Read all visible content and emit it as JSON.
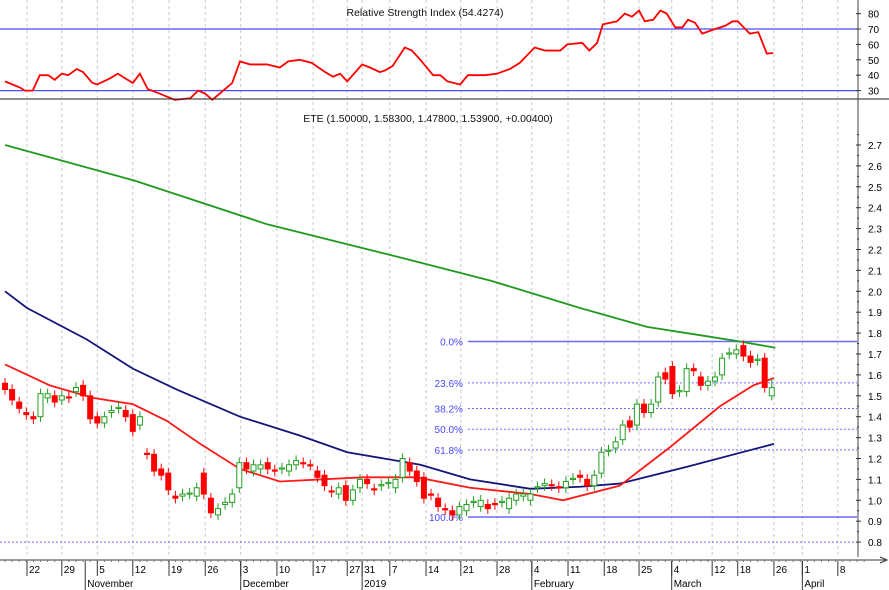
{
  "chart_data": {
    "type": "candlestick",
    "symbol": "ETE",
    "title": "ETE (1.50000, 1.58300, 1.47800, 1.53900, +0.00400)",
    "last_bar": {
      "open": 1.5,
      "high": 1.583,
      "low": 1.478,
      "close": 1.539,
      "change": 0.004
    },
    "ylim": [
      0.75,
      2.78
    ],
    "y_ticks": [
      "0.8",
      "0.9",
      "1.0",
      "1.1",
      "1.2",
      "1.3",
      "1.4",
      "1.5",
      "1.6",
      "1.7",
      "1.8",
      "1.9",
      "2.0",
      "2.1",
      "2.2",
      "2.3",
      "2.4",
      "2.5",
      "2.6",
      "2.7"
    ],
    "x_ticks": [
      {
        "label": "22",
        "i": 3.1
      },
      {
        "label": "29",
        "i": 8.0
      },
      {
        "label": "5",
        "i": 13.0
      },
      {
        "label": "12",
        "i": 18.0
      },
      {
        "label": "19",
        "i": 23.1
      },
      {
        "label": "26",
        "i": 28.2
      },
      {
        "label": "3",
        "i": 33.2
      },
      {
        "label": "10",
        "i": 38.3
      },
      {
        "label": "17",
        "i": 43.4
      },
      {
        "label": "27",
        "i": 48.2
      },
      {
        "label": "31",
        "i": 50.3
      },
      {
        "label": "7",
        "i": 54.2
      },
      {
        "label": "14",
        "i": 59.3
      },
      {
        "label": "21",
        "i": 64.2
      },
      {
        "label": "28",
        "i": 69.3
      },
      {
        "label": "4",
        "i": 74.2
      },
      {
        "label": "11",
        "i": 79.3
      },
      {
        "label": "18",
        "i": 84.4
      },
      {
        "label": "25",
        "i": 89.3
      },
      {
        "label": "4",
        "i": 93.9
      },
      {
        "label": "12",
        "i": 99.6
      },
      {
        "label": "18",
        "i": 103.2
      },
      {
        "label": "26",
        "i": 108.3
      },
      {
        "label": "1",
        "i": 112.3
      },
      {
        "label": "8",
        "i": 117.3
      }
    ],
    "months": [
      {
        "label": "November",
        "i": 11.3
      },
      {
        "label": "December",
        "i": 33.2
      },
      {
        "label": "2019",
        "i": 50.3
      },
      {
        "label": "February",
        "i": 74.2
      },
      {
        "label": "March",
        "i": 93.9
      },
      {
        "label": "April",
        "i": 112.3
      }
    ],
    "candles_oc": [
      [
        1.56,
        1.53
      ],
      [
        1.53,
        1.48
      ],
      [
        1.47,
        1.44
      ],
      [
        1.42,
        1.41
      ],
      [
        1.4,
        1.39
      ],
      [
        1.4,
        1.51
      ],
      [
        1.49,
        1.51
      ],
      [
        1.5,
        1.47
      ],
      [
        1.48,
        1.5
      ],
      [
        1.495,
        1.49
      ],
      [
        1.52,
        1.54
      ],
      [
        1.55,
        1.5
      ],
      [
        1.5,
        1.39
      ],
      [
        1.4,
        1.37
      ],
      [
        1.37,
        1.4
      ],
      [
        1.42,
        1.43
      ],
      [
        1.44,
        1.445
      ],
      [
        1.43,
        1.4
      ],
      [
        1.41,
        1.33
      ],
      [
        1.36,
        1.4
      ],
      [
        1.225,
        1.22
      ],
      [
        1.22,
        1.14
      ],
      [
        1.15,
        1.12
      ],
      [
        1.13,
        1.05
      ],
      [
        1.02,
        1.01
      ],
      [
        1.02,
        1.03
      ],
      [
        1.03,
        1.035
      ],
      [
        1.02,
        1.06
      ],
      [
        1.13,
        1.03
      ],
      [
        1.01,
        0.94
      ],
      [
        0.93,
        0.96
      ],
      [
        0.98,
        0.99
      ],
      [
        0.99,
        1.03
      ],
      [
        1.06,
        1.18
      ],
      [
        1.18,
        1.15
      ],
      [
        1.14,
        1.17
      ],
      [
        1.15,
        1.17
      ],
      [
        1.18,
        1.15
      ],
      [
        1.145,
        1.14
      ],
      [
        1.15,
        1.155
      ],
      [
        1.14,
        1.17
      ],
      [
        1.17,
        1.19
      ],
      [
        1.18,
        1.178
      ],
      [
        1.17,
        1.168
      ],
      [
        1.14,
        1.11
      ],
      [
        1.12,
        1.07
      ],
      [
        1.045,
        1.04
      ],
      [
        1.03,
        1.06
      ],
      [
        1.07,
        1.0
      ],
      [
        1.0,
        1.05
      ],
      [
        1.06,
        1.1
      ],
      [
        1.1,
        1.08
      ],
      [
        1.055,
        1.05
      ],
      [
        1.07,
        1.075
      ],
      [
        1.08,
        1.085
      ],
      [
        1.06,
        1.1
      ],
      [
        1.11,
        1.2
      ],
      [
        1.18,
        1.14
      ],
      [
        1.14,
        1.09
      ],
      [
        1.11,
        1.01
      ],
      [
        1.03,
        1.025
      ],
      [
        1.01,
        0.97
      ],
      [
        0.96,
        0.955
      ],
      [
        0.95,
        0.93
      ],
      [
        0.93,
        0.97
      ],
      [
        0.95,
        0.98
      ],
      [
        0.99,
        0.995
      ],
      [
        0.97,
        1.0
      ],
      [
        0.98,
        0.96
      ],
      [
        0.985,
        0.98
      ],
      [
        0.99,
        0.995
      ],
      [
        0.96,
        1.01
      ],
      [
        1.0,
        1.03
      ],
      [
        1.02,
        1.03
      ],
      [
        1.0,
        1.03
      ],
      [
        1.06,
        1.065
      ],
      [
        1.07,
        1.08
      ],
      [
        1.075,
        1.07
      ],
      [
        1.065,
        1.06
      ],
      [
        1.06,
        1.09
      ],
      [
        1.1,
        1.105
      ],
      [
        1.12,
        1.11
      ],
      [
        1.1,
        1.07
      ],
      [
        1.07,
        1.12
      ],
      [
        1.13,
        1.23
      ],
      [
        1.235,
        1.24
      ],
      [
        1.25,
        1.28
      ],
      [
        1.29,
        1.36
      ],
      [
        1.38,
        1.35
      ],
      [
        1.36,
        1.46
      ],
      [
        1.46,
        1.42
      ],
      [
        1.42,
        1.46
      ],
      [
        1.47,
        1.59
      ],
      [
        1.61,
        1.58
      ],
      [
        1.64,
        1.51
      ],
      [
        1.52,
        1.525
      ],
      [
        1.52,
        1.63
      ],
      [
        1.63,
        1.62
      ],
      [
        1.59,
        1.55
      ],
      [
        1.55,
        1.57
      ],
      [
        1.57,
        1.59
      ],
      [
        1.6,
        1.68
      ],
      [
        1.7,
        1.705
      ],
      [
        1.7,
        1.72
      ],
      [
        1.74,
        1.69
      ],
      [
        1.69,
        1.66
      ],
      [
        1.67,
        1.675
      ],
      [
        1.68,
        1.54
      ],
      [
        1.5,
        1.539
      ]
    ],
    "moving_averages": [
      {
        "name": "long",
        "color": "#1f9a1f",
        "points": [
          [
            0,
            2.7
          ],
          [
            18.2,
            2.53
          ],
          [
            37,
            2.32
          ],
          [
            55.9,
            2.16
          ],
          [
            68.5,
            2.05
          ],
          [
            81,
            1.92
          ],
          [
            90.4,
            1.83
          ],
          [
            97.9,
            1.79
          ],
          [
            103.5,
            1.76
          ],
          [
            108.5,
            1.73
          ]
        ]
      },
      {
        "name": "medium",
        "color": "#14147a",
        "points": [
          [
            0,
            2.0
          ],
          [
            3.1,
            1.92
          ],
          [
            11.5,
            1.77
          ],
          [
            18,
            1.63
          ],
          [
            24.2,
            1.53
          ],
          [
            33.1,
            1.4
          ],
          [
            41.5,
            1.31
          ],
          [
            48.2,
            1.23
          ],
          [
            58.5,
            1.17
          ],
          [
            65.5,
            1.1
          ],
          [
            74,
            1.055
          ],
          [
            81,
            1.065
          ],
          [
            86.6,
            1.08
          ],
          [
            96,
            1.16
          ],
          [
            108.3,
            1.27
          ]
        ]
      },
      {
        "name": "short",
        "color": "#ff1a1a",
        "points": [
          [
            0,
            1.65
          ],
          [
            6.3,
            1.55
          ],
          [
            12.4,
            1.49
          ],
          [
            18,
            1.46
          ],
          [
            22.8,
            1.38
          ],
          [
            27.5,
            1.27
          ],
          [
            33.1,
            1.15
          ],
          [
            38.7,
            1.09
          ],
          [
            50.4,
            1.11
          ],
          [
            58,
            1.11
          ],
          [
            65.5,
            1.06
          ],
          [
            74,
            1.03
          ],
          [
            78.6,
            1.0
          ],
          [
            86.6,
            1.07
          ],
          [
            93.7,
            1.255
          ],
          [
            100.7,
            1.45
          ],
          [
            105.4,
            1.55
          ],
          [
            108.3,
            1.585
          ]
        ]
      }
    ],
    "fibonacci": {
      "high": 1.76,
      "low": 0.92,
      "anchor_i": 65.2,
      "levels": [
        {
          "label": "0.0%",
          "value": 1.76,
          "style": "solid"
        },
        {
          "label": "23.6%",
          "value": 1.562,
          "style": "dotted"
        },
        {
          "label": "38.2%",
          "value": 1.439,
          "style": "dotted"
        },
        {
          "label": "50.0%",
          "value": 1.34,
          "style": "dotted"
        },
        {
          "label": "61.8%",
          "value": 1.241,
          "style": "dotted"
        },
        {
          "label": "100.0%",
          "value": 0.92,
          "style": "solid"
        }
      ],
      "extra_line": 0.8
    },
    "rsi": {
      "title": "Relative Strength Index (54.4274)",
      "ylim": [
        20,
        90
      ],
      "levels": [
        70,
        30
      ],
      "y_ticks": [
        "80",
        "70",
        "60",
        "50",
        "40",
        "30"
      ],
      "points": [
        [
          0,
          36
        ],
        [
          2.1,
          32
        ],
        [
          2.8,
          30
        ],
        [
          3.9,
          30
        ],
        [
          4.9,
          40
        ],
        [
          6.1,
          40
        ],
        [
          7,
          37
        ],
        [
          8,
          41
        ],
        [
          8.9,
          40
        ],
        [
          10.1,
          44
        ],
        [
          11,
          42
        ],
        [
          12.3,
          35
        ],
        [
          13,
          34
        ],
        [
          14.8,
          38
        ],
        [
          15.9,
          41
        ],
        [
          16.9,
          38
        ],
        [
          18,
          35
        ],
        [
          19,
          41
        ],
        [
          20.1,
          31
        ],
        [
          21.8,
          28
        ],
        [
          23.9,
          24
        ],
        [
          26.1,
          25
        ],
        [
          27.2,
          30
        ],
        [
          28.2,
          28
        ],
        [
          29.2,
          24
        ],
        [
          31,
          31
        ],
        [
          32,
          35
        ],
        [
          33.1,
          49
        ],
        [
          34.5,
          47
        ],
        [
          35.2,
          47
        ],
        [
          36.9,
          47
        ],
        [
          38.7,
          45
        ],
        [
          39.9,
          49
        ],
        [
          41.5,
          50
        ],
        [
          43.2,
          48
        ],
        [
          45.1,
          42
        ],
        [
          46.2,
          39
        ],
        [
          47.2,
          41
        ],
        [
          48.2,
          36
        ],
        [
          50.3,
          47
        ],
        [
          51.4,
          45
        ],
        [
          52.8,
          42
        ],
        [
          53.5,
          43
        ],
        [
          54.6,
          46
        ],
        [
          56.3,
          58
        ],
        [
          57.3,
          56
        ],
        [
          58.5,
          50
        ],
        [
          60.3,
          40
        ],
        [
          61.3,
          40
        ],
        [
          62.3,
          36
        ],
        [
          64.1,
          34
        ],
        [
          65.2,
          40
        ],
        [
          67.6,
          40
        ],
        [
          69.3,
          41
        ],
        [
          71.1,
          44
        ],
        [
          72.5,
          48
        ],
        [
          74.6,
          58
        ],
        [
          76.1,
          56
        ],
        [
          78.2,
          56
        ],
        [
          79.2,
          60
        ],
        [
          81.3,
          61
        ],
        [
          82.3,
          56
        ],
        [
          83.4,
          61
        ],
        [
          84.2,
          73
        ],
        [
          86.2,
          75
        ],
        [
          87.3,
          80
        ],
        [
          88.3,
          78
        ],
        [
          89.3,
          82
        ],
        [
          90.1,
          75
        ],
        [
          91.3,
          76
        ],
        [
          92.3,
          82
        ],
        [
          93.2,
          80
        ],
        [
          94.4,
          71
        ],
        [
          95.4,
          71
        ],
        [
          96.2,
          76
        ],
        [
          97.2,
          74
        ],
        [
          98.2,
          67
        ],
        [
          100,
          70
        ],
        [
          101.4,
          72
        ],
        [
          102.5,
          75
        ],
        [
          103.2,
          75
        ],
        [
          104.9,
          67
        ],
        [
          106.1,
          68
        ],
        [
          107.3,
          54
        ],
        [
          108.2,
          54.4
        ]
      ]
    },
    "colors": {
      "up": "#22a022",
      "down": "#ff0000",
      "rsi_line": "#ff0000",
      "rsi_levels": "#4a4aff",
      "fib": "#6a6aff",
      "grid": "#c8c8c8"
    }
  }
}
